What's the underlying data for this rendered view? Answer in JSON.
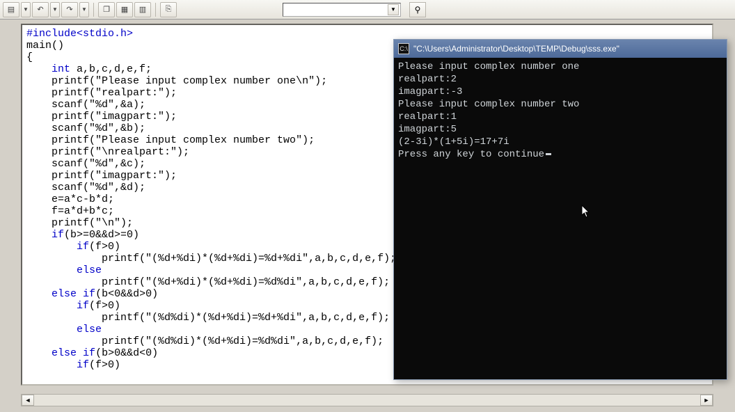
{
  "toolbar": {
    "buttons": [
      "file",
      "undo",
      "redo",
      "window-cascade",
      "window-tile",
      "window-arrange",
      "toggle"
    ]
  },
  "editor": {
    "code_lines": [
      {
        "t": "pp",
        "v": "#include<stdio.h>"
      },
      {
        "t": "",
        "v": "main()"
      },
      {
        "t": "",
        "v": "{"
      },
      {
        "t": "idt1",
        "v": "int a,b,c,d,e,f;",
        "kw": "int"
      },
      {
        "t": "idt1",
        "v": "printf(\"Please input complex number one\\n\");"
      },
      {
        "t": "idt1",
        "v": "printf(\"realpart:\");"
      },
      {
        "t": "idt1",
        "v": "scanf(\"%d\",&a);"
      },
      {
        "t": "idt1",
        "v": "printf(\"imagpart:\");"
      },
      {
        "t": "idt1",
        "v": "scanf(\"%d\",&b);"
      },
      {
        "t": "idt1",
        "v": "printf(\"Please input complex number two\");"
      },
      {
        "t": "idt1",
        "v": "printf(\"\\nrealpart:\");"
      },
      {
        "t": "idt1",
        "v": "scanf(\"%d\",&c);"
      },
      {
        "t": "idt1",
        "v": "printf(\"imagpart:\");"
      },
      {
        "t": "idt1",
        "v": "scanf(\"%d\",&d);"
      },
      {
        "t": "idt1",
        "v": "e=a*c-b*d;"
      },
      {
        "t": "idt1",
        "v": "f=a*d+b*c;"
      },
      {
        "t": "idt1",
        "v": "printf(\"\\n\");"
      },
      {
        "t": "idt1",
        "v": "if(b>=0&&d>=0)",
        "kw": "if"
      },
      {
        "t": "idt2",
        "v": "if(f>0)",
        "kw": "if"
      },
      {
        "t": "idt3",
        "v": "printf(\"(%d+%di)*(%d+%di)=%d+%di\",a,b,c,d,e,f);"
      },
      {
        "t": "idt2",
        "v": "else",
        "kw": "else"
      },
      {
        "t": "idt3",
        "v": "printf(\"(%d+%di)*(%d+%di)=%d%di\",a,b,c,d,e,f);"
      },
      {
        "t": "idt1",
        "v": "else if(b<0&&d>0)",
        "kw": "else"
      },
      {
        "t": "idt2",
        "v": "if(f>0)",
        "kw": "if"
      },
      {
        "t": "idt3",
        "v": "printf(\"(%d%di)*(%d+%di)=%d+%di\",a,b,c,d,e,f);"
      },
      {
        "t": "idt2",
        "v": "else",
        "kw": "else"
      },
      {
        "t": "idt3",
        "v": "printf(\"(%d%di)*(%d+%di)=%d%di\",a,b,c,d,e,f);"
      },
      {
        "t": "idt1",
        "v": "else if(b>0&&d<0)",
        "kw": "else"
      },
      {
        "t": "idt2",
        "v": "if(f>0)",
        "kw": "if"
      }
    ]
  },
  "console": {
    "title": "\"C:\\Users\\Administrator\\Desktop\\TEMP\\Debug\\sss.exe\"",
    "lines": [
      "Please input complex number one",
      "realpart:2",
      "imagpart:-3",
      "Please input complex number two",
      "realpart:1",
      "imagpart:5",
      "",
      "(2-3i)*(1+5i)=17+7i",
      "Press any key to continue"
    ]
  }
}
